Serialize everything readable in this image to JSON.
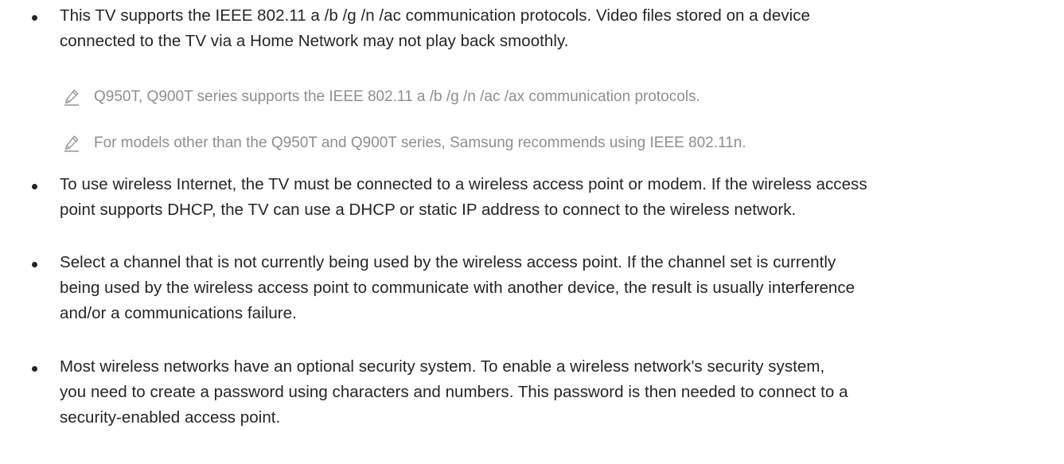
{
  "content": {
    "bullets": [
      {
        "lines": [
          "This TV supports the IEEE 802.11 a /b /g /n /ac communication protocols. Video files stored on a device",
          "connected to the TV via a Home Network may not play back smoothly."
        ]
      },
      {
        "lines": [
          "To use wireless Internet, the TV must be connected to a wireless access point or modem. If the wireless access",
          "point supports DHCP, the TV can use a DHCP or static IP address to connect to the wireless network."
        ]
      },
      {
        "lines": [
          "Select a channel that is not currently being used by the wireless access point. If the channel set is currently",
          "being used by the wireless access point to communicate with another device, the result is usually interference",
          "and/or a communications failure."
        ]
      },
      {
        "lines": [
          "Most wireless networks have an optional security system. To enable a wireless network's security system,",
          "you need to create a password using characters and numbers. This password is then needed to connect to a",
          "security-enabled access point."
        ]
      }
    ],
    "notes": [
      {
        "text": "Q950T, Q900T series supports the IEEE 802.11 a /b /g /n /ac /ax communication protocols.",
        "icon": "pencil-icon"
      },
      {
        "text": "For models other than the Q950T and Q900T series, Samsung recommends using IEEE 802.11n.",
        "icon": "pencil-icon"
      }
    ]
  },
  "colors": {
    "text": "#252525",
    "note_text": "#8e8e8e",
    "icon": "#9a9a9a"
  }
}
